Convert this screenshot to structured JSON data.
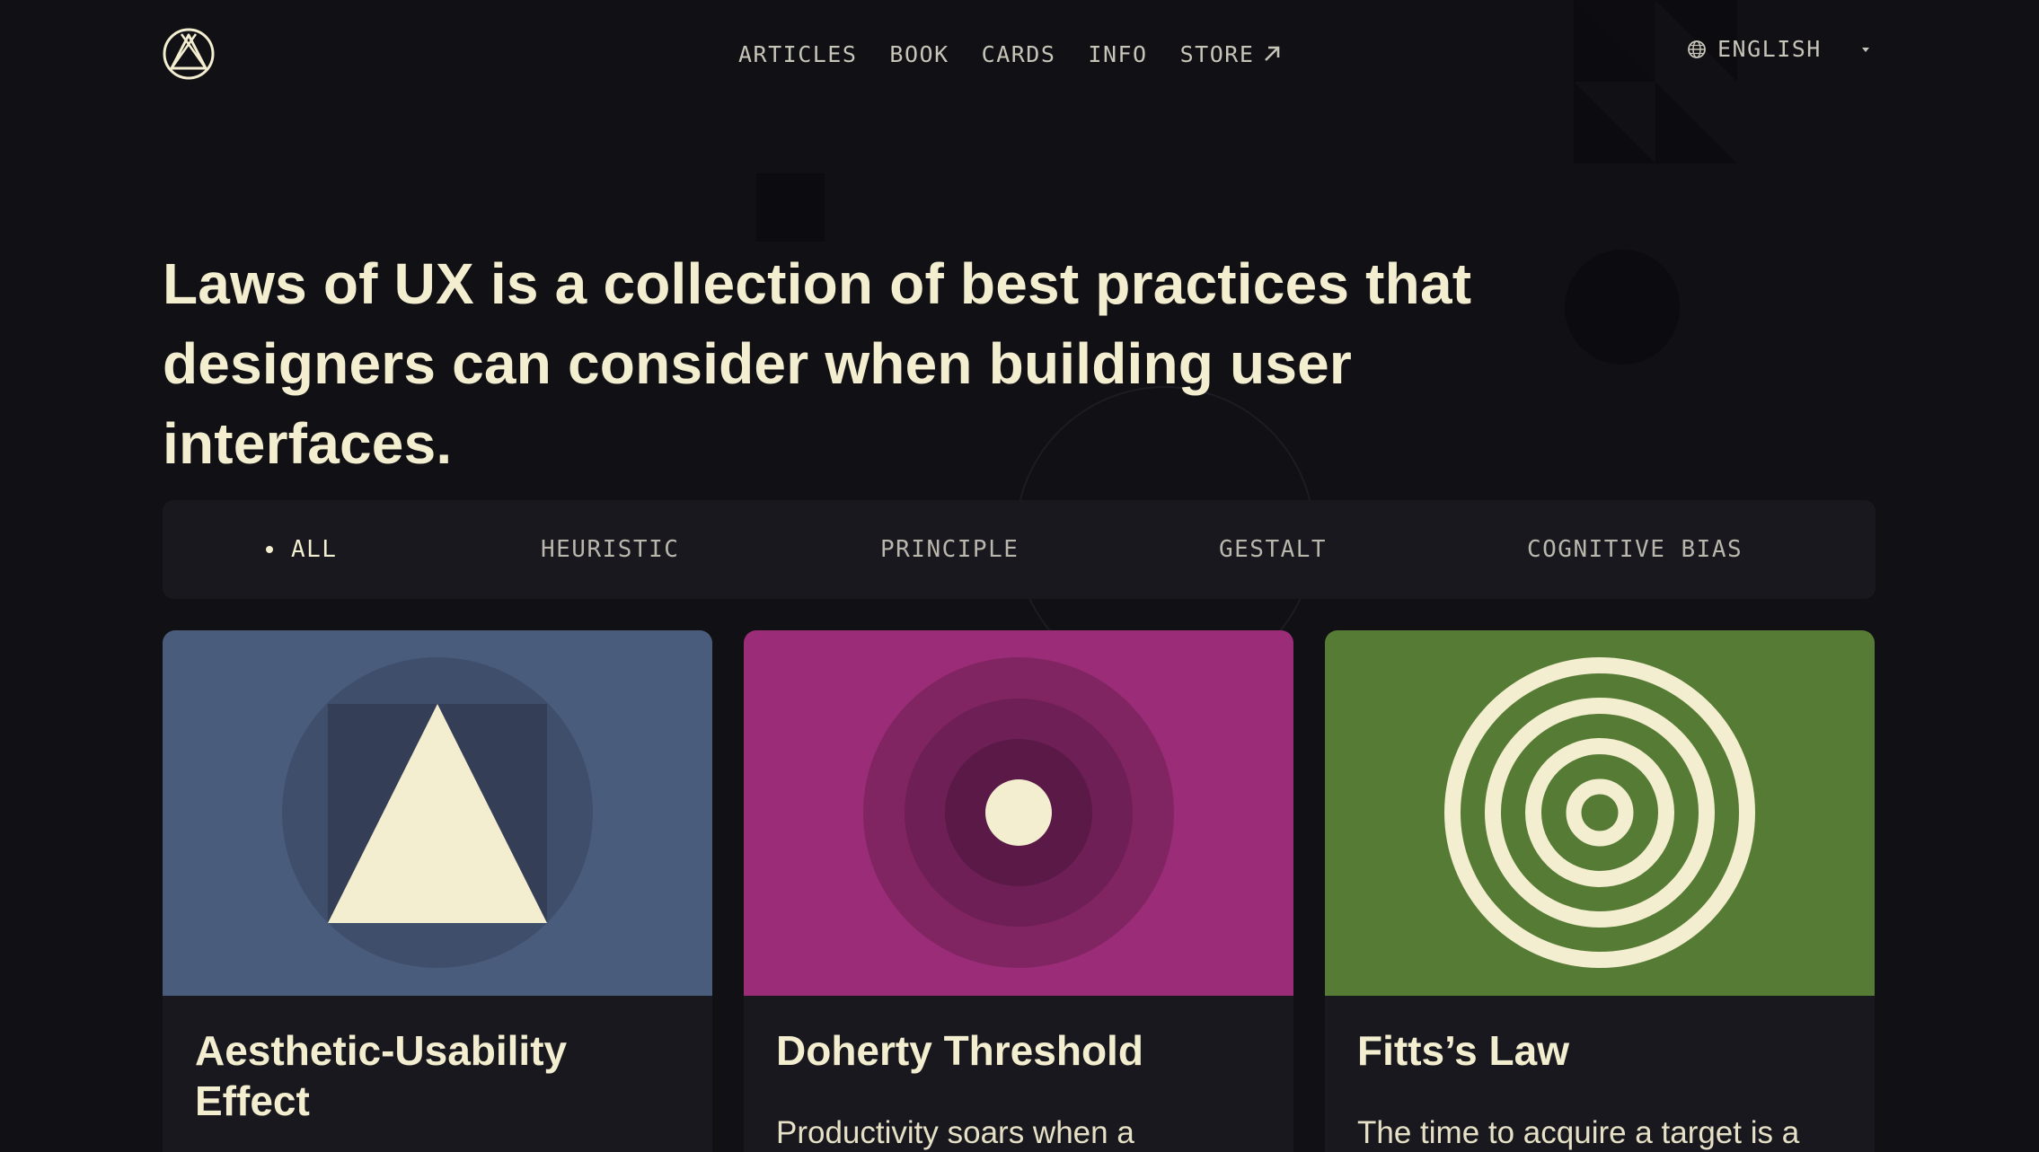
{
  "header": {
    "nav": [
      {
        "label": "ARTICLES"
      },
      {
        "label": "BOOK"
      },
      {
        "label": "CARDS"
      },
      {
        "label": "INFO"
      },
      {
        "label": "STORE",
        "icon": "external-arrow-icon"
      }
    ],
    "language": {
      "label": "ENGLISH",
      "icon": "globe-icon"
    }
  },
  "hero": {
    "line1": "Laws of UX is a collection of best practices that",
    "line2": "designers can consider when building user interfaces."
  },
  "filters": [
    {
      "label": "ALL",
      "active": true
    },
    {
      "label": "HEURISTIC"
    },
    {
      "label": "PRINCIPLE"
    },
    {
      "label": "GESTALT"
    },
    {
      "label": "COGNITIVE BIAS"
    }
  ],
  "cards": [
    {
      "title": "Aesthetic-Usability Effect",
      "description": "",
      "color": "#4a5c7c"
    },
    {
      "title": "Doherty Threshold",
      "description": "Productivity soars when a",
      "color": "#9a2c78"
    },
    {
      "title": "Fitts’s Law",
      "description": "The time to acquire a target is a",
      "color": "#567b35"
    }
  ],
  "colors": {
    "background": "#111015",
    "surface": "#19181f",
    "text": "#f3eed0"
  }
}
